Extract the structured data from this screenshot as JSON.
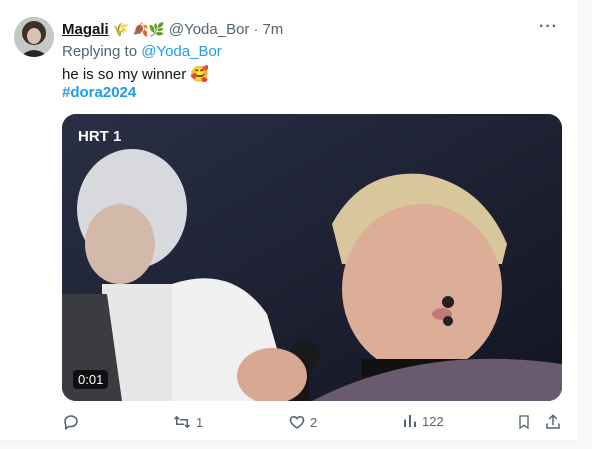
{
  "tweet": {
    "display_name": "Magali",
    "name_emojis": "🌾 🍂🌿",
    "handle": "@Yoda_Bor",
    "separator": "·",
    "time": "7m",
    "more_label": "···",
    "replying_to_label": "Replying to",
    "replying_to_handle": "@Yoda_Bor",
    "text": "he is so my winner 🥰",
    "hashtag": "#dora2024"
  },
  "media": {
    "channel_logo": "HRT 1",
    "duration": "0:01"
  },
  "actions": {
    "reply_icon": "reply-icon",
    "retweet_count": "1",
    "like_count": "2",
    "views_count": "122",
    "bookmark_icon": "bookmark-icon",
    "share_icon": "share-icon"
  },
  "colors": {
    "accent": "#1d9bf0",
    "muted": "#536471",
    "text": "#0f1419"
  }
}
